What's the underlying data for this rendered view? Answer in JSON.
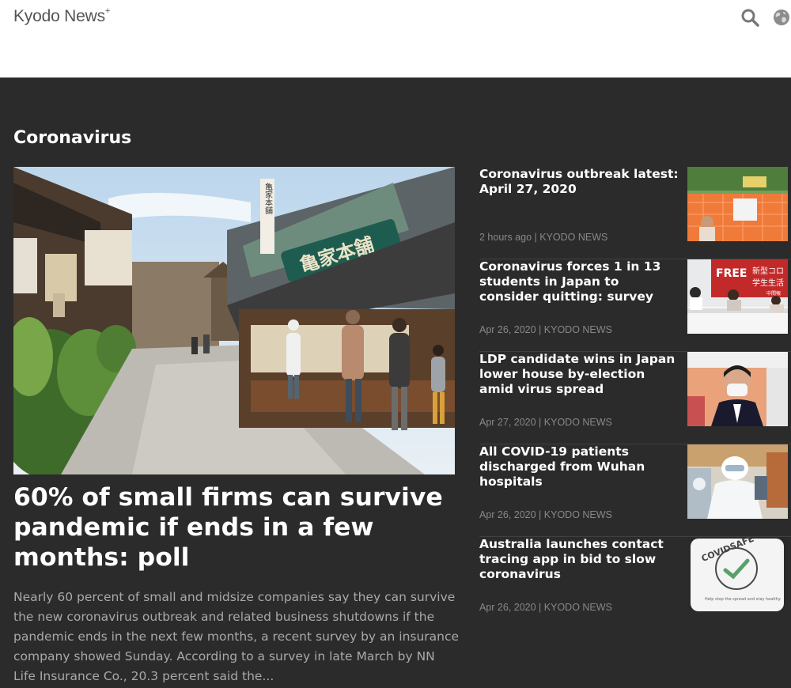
{
  "header": {
    "logo_text": "Kyodo News",
    "logo_sup": "+",
    "icons": [
      "search-icon",
      "globe-icon"
    ]
  },
  "section": {
    "title": "Coronavirus"
  },
  "lead": {
    "title": "60% of small firms can survive pandemic if ends in a few months: poll",
    "summary": "Nearly 60 percent of small and midsize companies say they can survive the new coronavirus outbreak and related business shutdowns if the pandemic ends in the next few months, a recent survey by an insurance company showed Sunday. According to a survey in late March by NN Life Insurance Co., 20.3 percent said the..."
  },
  "articles": [
    {
      "title": "Coronavirus outbreak latest: April 27, 2020",
      "meta": "2 hours ago | KYODO NEWS"
    },
    {
      "title": "Coronavirus forces 1 in 13 students in Japan to consider quitting: survey",
      "meta": "Apr 26, 2020 | KYODO NEWS"
    },
    {
      "title": "LDP candidate wins in Japan lower house by-election amid virus spread",
      "meta": "Apr 27, 2020 | KYODO NEWS"
    },
    {
      "title": "All COVID-19 patients discharged from Wuhan hospitals",
      "meta": "Apr 26, 2020 | KYODO NEWS"
    },
    {
      "title": "Australia launches contact tracing app in bid to slow coronavirus",
      "meta": "Apr 26, 2020 | KYODO NEWS"
    }
  ],
  "thumb_text": {
    "lead_sign": "亀家本舗",
    "lead_vsign": "亀家本舗",
    "free_banner": "FREE",
    "jp_banner_1": "新型コロ",
    "jp_banner_2": "学生生活",
    "jp_banner_3": "中間報",
    "app_logo": "COVIDSAFE",
    "app_small": "Help stop the spread and stay healthy."
  }
}
